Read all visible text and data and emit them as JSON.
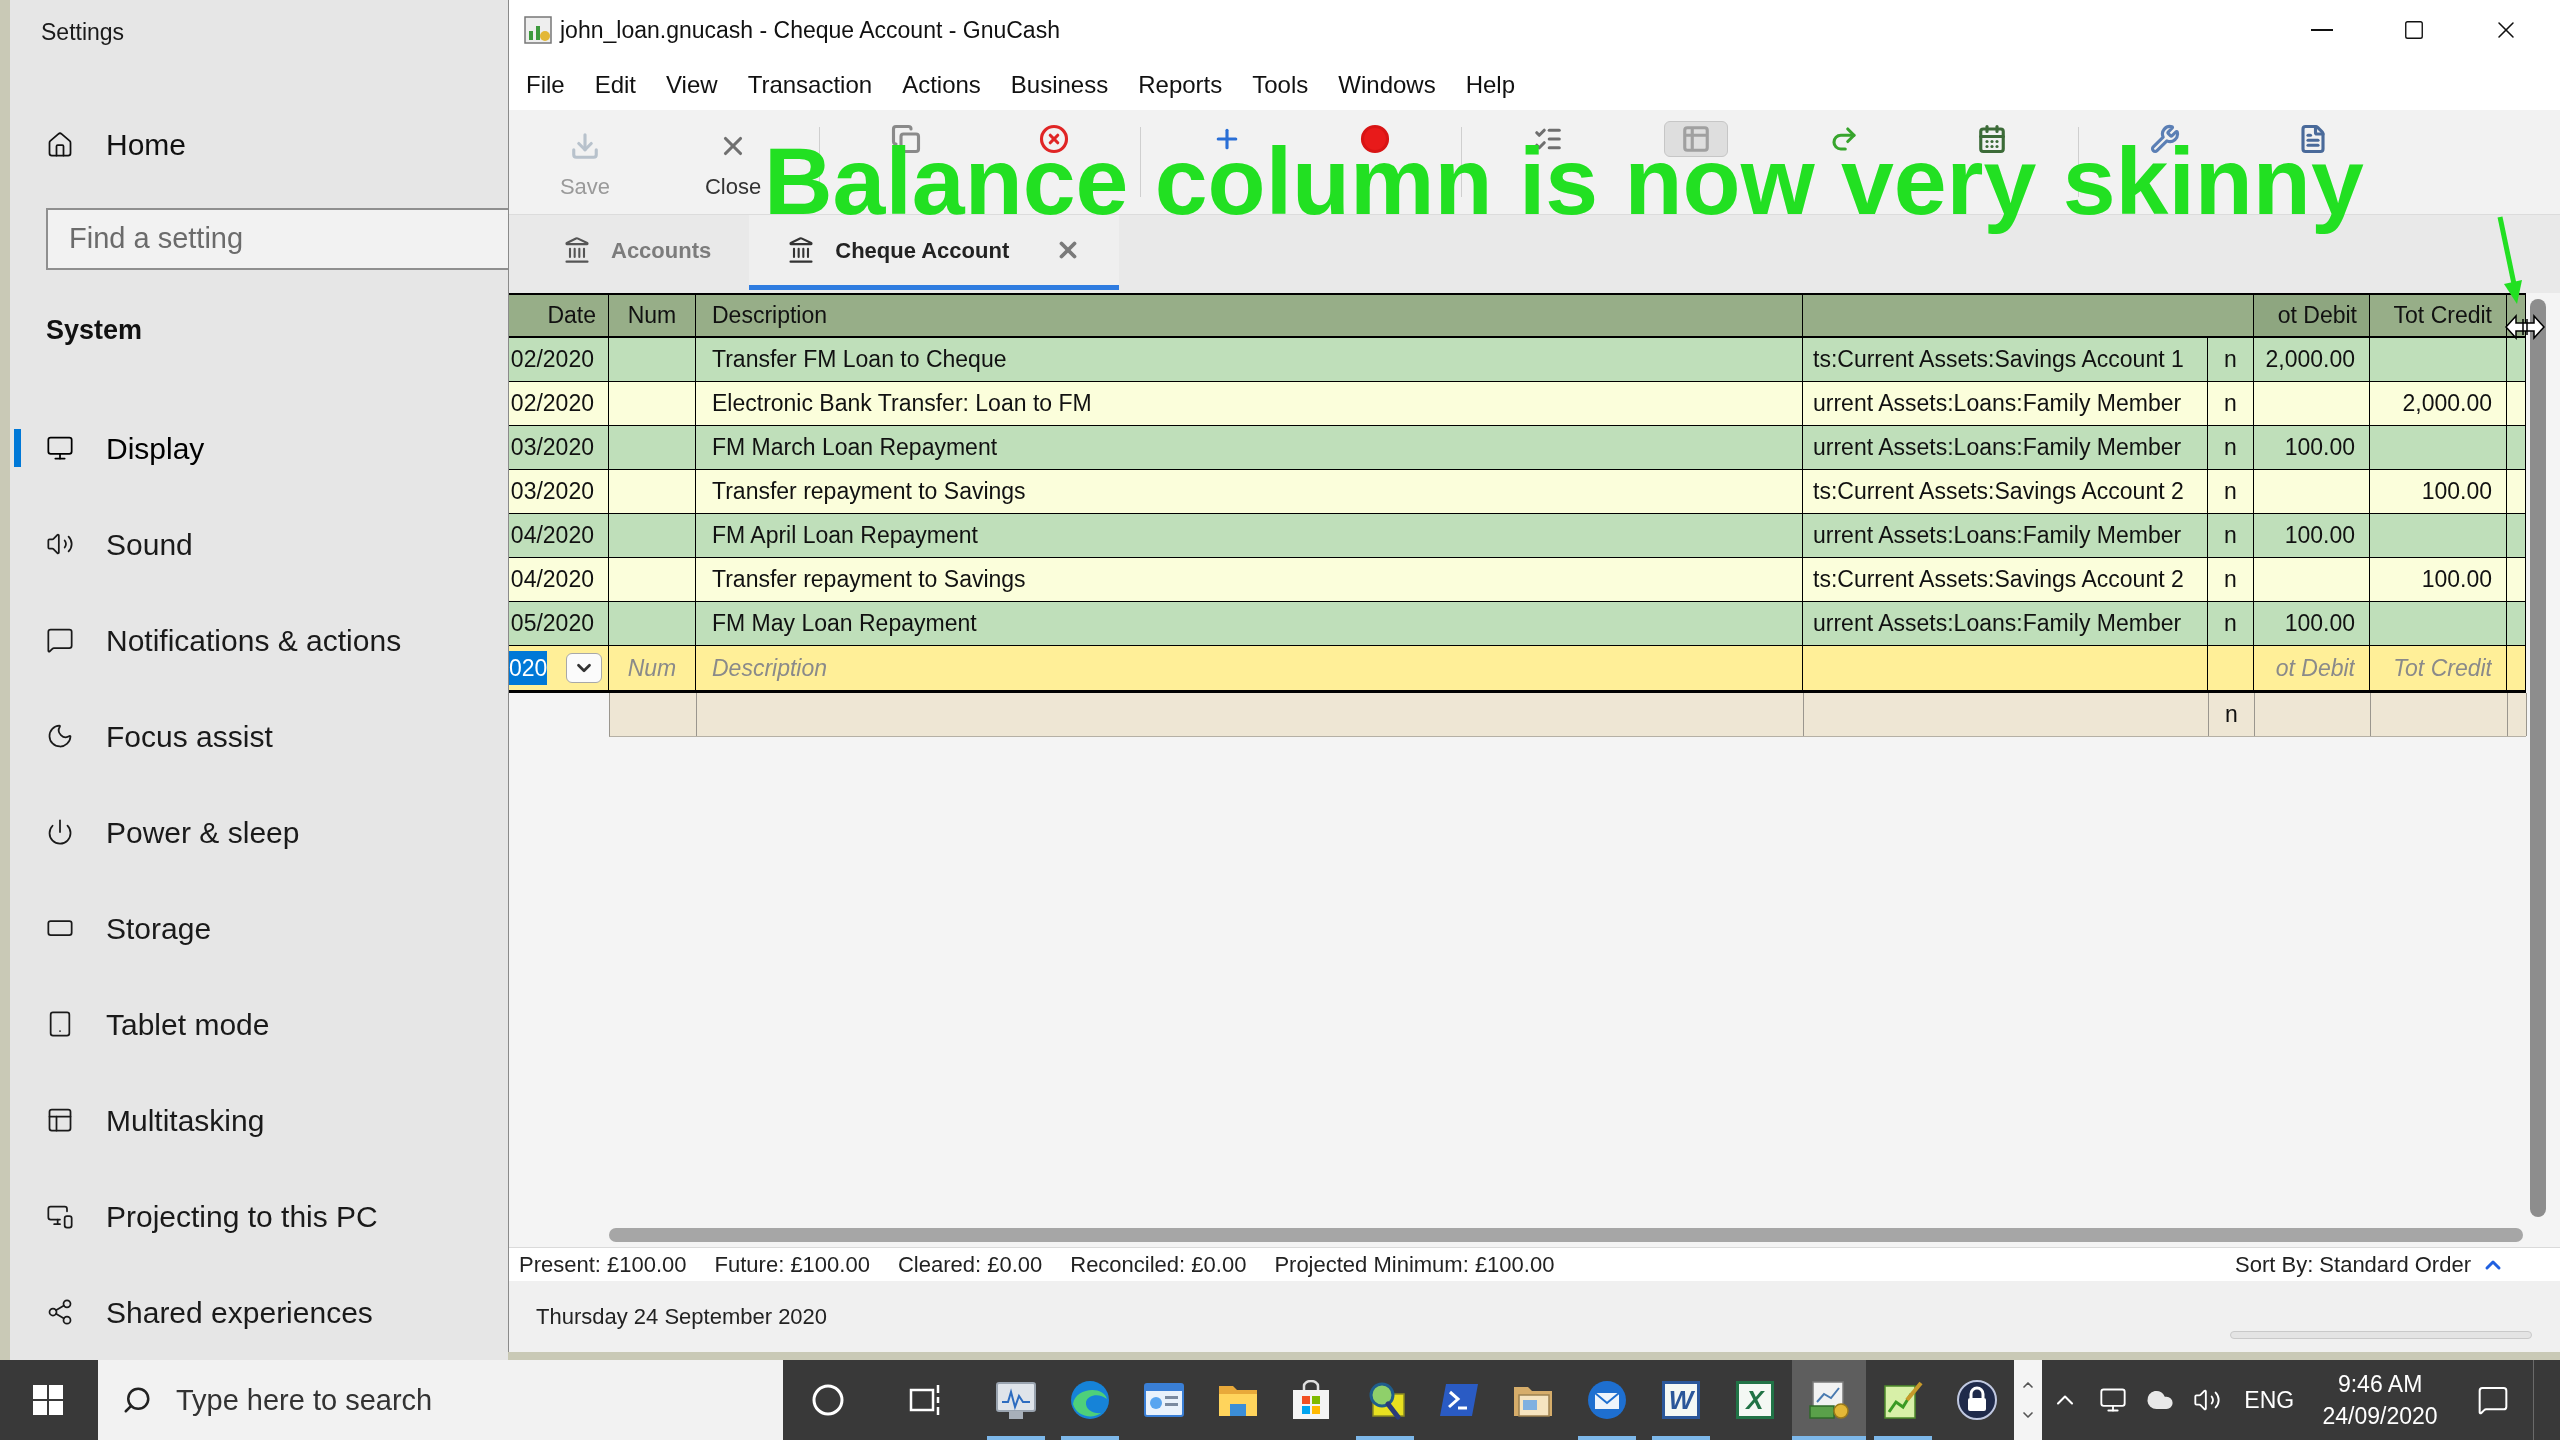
{
  "settings": {
    "title": "Settings",
    "home": "Home",
    "search": {
      "placeholder": "Find a setting"
    },
    "section": "System",
    "items": [
      {
        "label": "Display",
        "kind": "display",
        "selected": true
      },
      {
        "label": "Sound",
        "kind": "sound",
        "selected": false
      },
      {
        "label": "Notifications & actions",
        "kind": "notifications",
        "selected": false
      },
      {
        "label": "Focus assist",
        "kind": "focus",
        "selected": false
      },
      {
        "label": "Power & sleep",
        "kind": "power",
        "selected": false
      },
      {
        "label": "Storage",
        "kind": "storage",
        "selected": false
      },
      {
        "label": "Tablet mode",
        "kind": "tablet",
        "selected": false
      },
      {
        "label": "Multitasking",
        "kind": "multitasking",
        "selected": false
      },
      {
        "label": "Projecting to this PC",
        "kind": "projecting",
        "selected": false
      },
      {
        "label": "Shared experiences",
        "kind": "shared",
        "selected": false
      }
    ]
  },
  "window": {
    "title": "john_loan.gnucash - Cheque Account - GnuCash"
  },
  "menu": [
    "File",
    "Edit",
    "View",
    "Transaction",
    "Actions",
    "Business",
    "Reports",
    "Tools",
    "Windows",
    "Help"
  ],
  "toolbar": {
    "groups": [
      {
        "buttons": [
          {
            "kind": "save",
            "label": "Save",
            "disabled": true,
            "pressed": false
          },
          {
            "kind": "close",
            "label": "Close",
            "disabled": false,
            "pressed": false
          }
        ]
      },
      {
        "buttons": [
          {
            "kind": "duplicate",
            "disabled": false,
            "pressed": false
          },
          {
            "kind": "delete",
            "disabled": false,
            "pressed": false
          }
        ]
      },
      {
        "buttons": [
          {
            "kind": "enter",
            "disabled": false,
            "pressed": false
          },
          {
            "kind": "cancel",
            "disabled": false,
            "pressed": false
          }
        ]
      },
      {
        "buttons": [
          {
            "kind": "blank",
            "disabled": false,
            "pressed": false
          },
          {
            "kind": "split",
            "disabled": false,
            "pressed": true
          },
          {
            "kind": "jump",
            "disabled": false,
            "pressed": false
          },
          {
            "kind": "schedule",
            "disabled": false,
            "pressed": false
          }
        ]
      },
      {
        "buttons": [
          {
            "kind": "transfer",
            "disabled": false,
            "pressed": false
          },
          {
            "kind": "reconcile",
            "disabled": false,
            "pressed": false
          }
        ]
      }
    ]
  },
  "annotation": {
    "text": "Balance column is now very skinny"
  },
  "tabs": [
    {
      "label": "Accounts",
      "selected": false,
      "closable": false
    },
    {
      "label": "Cheque Account",
      "selected": true,
      "closable": true
    }
  ],
  "register": {
    "columns": {
      "date": "Date",
      "num": "Num",
      "description": "Description",
      "tot_debit": "ot Debit",
      "tot_credit": "Tot Credit"
    },
    "rows": [
      {
        "date": "02/2020",
        "description": "Transfer FM Loan to Cheque",
        "column_4": "ts:Current Assets:Savings Account 1",
        "column_5": "n",
        "tot_debit": "2,000.00"
      },
      {
        "date": "02/2020",
        "description": "Electronic Bank Transfer: Loan to FM",
        "column_4": "urrent Assets:Loans:Family Member",
        "column_5": "n",
        "tot_credit": "2,000.00"
      },
      {
        "date": "03/2020",
        "description": "FM March Loan Repayment",
        "column_4": "urrent Assets:Loans:Family Member",
        "column_5": "n",
        "tot_debit": "100.00"
      },
      {
        "date": "03/2020",
        "description": "Transfer repayment to Savings",
        "column_4": "ts:Current Assets:Savings Account 2",
        "column_5": "n",
        "tot_credit": "100.00"
      },
      {
        "date": "04/2020",
        "description": "FM April Loan Repayment",
        "column_4": "urrent Assets:Loans:Family Member",
        "column_5": "n",
        "tot_debit": "100.00"
      },
      {
        "date": "04/2020",
        "description": "Transfer repayment to Savings",
        "column_4": "ts:Current Assets:Savings Account 2",
        "column_5": "n",
        "tot_credit": "100.00"
      },
      {
        "date": "05/2020",
        "description": "FM May Loan Repayment",
        "column_4": "urrent Assets:Loans:Family Member",
        "column_5": "n",
        "tot_debit": "100.00"
      }
    ],
    "entry_row": {
      "date": "020",
      "date_selected": true,
      "num": {
        "placeholder": "Num"
      },
      "description": {
        "placeholder": "Description"
      },
      "tot_debit": {
        "placeholder": "ot Debit"
      },
      "tot_credit": {
        "placeholder": "Tot Credit"
      }
    },
    "split_row": {
      "column_5": "n"
    }
  },
  "status_bar": {
    "items": [
      "Present: £100.00",
      "Future: £100.00",
      "Cleared: £0.00",
      "Reconciled: £0.00",
      "Projected Minimum: £100.00"
    ],
    "sort": "Sort By: Standard Order"
  },
  "date_bar": {
    "date": "Thursday 24 September 2020",
    "progress": {
      "level": 0
    }
  },
  "taskbar": {
    "search": {
      "placeholder": "Type here to search"
    },
    "apps": [
      {
        "kind": "monitor-chart",
        "running": true,
        "active": false
      },
      {
        "kind": "browser",
        "running": true,
        "active": false
      },
      {
        "kind": "control-panel",
        "running": false,
        "active": false
      },
      {
        "kind": "folder",
        "running": false,
        "active": false
      },
      {
        "kind": "store",
        "running": false,
        "active": false
      },
      {
        "kind": "magnifier",
        "running": true,
        "active": false
      },
      {
        "kind": "terminal",
        "running": false,
        "active": false
      },
      {
        "kind": "folder-window",
        "running": false,
        "active": false
      },
      {
        "kind": "mail",
        "running": true,
        "active": false
      },
      {
        "kind": "letter-tile",
        "letter": "W",
        "color": "#2b579a",
        "running": true,
        "active": false
      },
      {
        "kind": "letter-tile",
        "letter": "X",
        "color": "#217346",
        "running": false,
        "active": false
      },
      {
        "kind": "ledger",
        "running": true,
        "active": true
      },
      {
        "kind": "chart-pen",
        "running": true,
        "active": false
      },
      {
        "kind": "lock",
        "running": false,
        "active": false
      }
    ],
    "tray": {
      "language": "ENG",
      "time": "9:46 AM",
      "date": "24/09/2020"
    }
  }
}
